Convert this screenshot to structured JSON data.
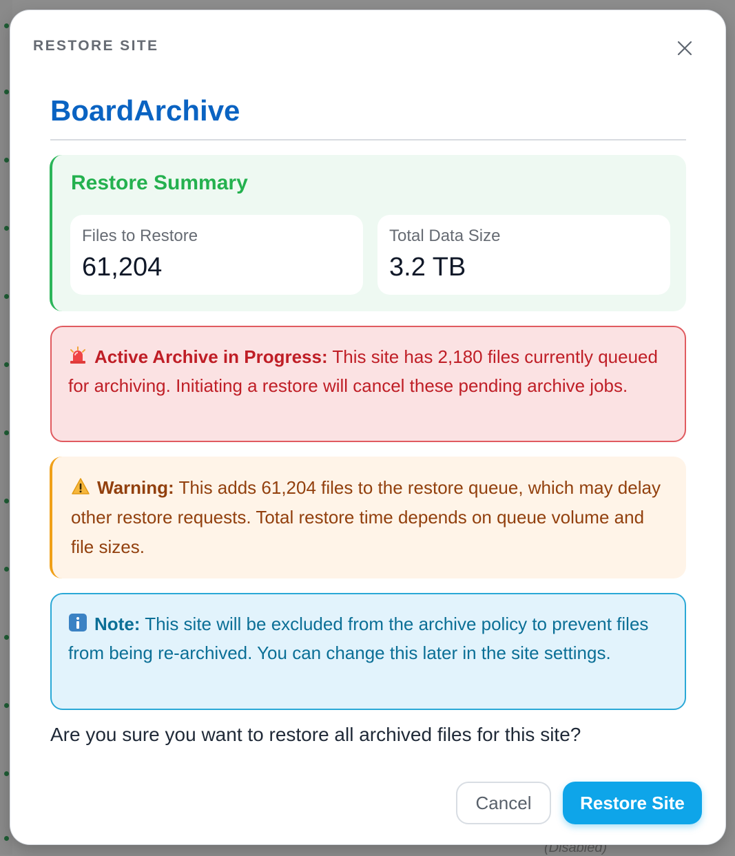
{
  "backdrop": {
    "hint_text": "(Disabled)"
  },
  "modal": {
    "header_label": "RESTORE SITE",
    "site_title": "BoardArchive",
    "summary": {
      "title": "Restore Summary",
      "files_label": "Files to Restore",
      "files_value": "61,204",
      "size_label": "Total Data Size",
      "size_value": "3.2 TB"
    },
    "alert_error": {
      "icon": "siren-icon",
      "title": "Active Archive in Progress:",
      "body": "This site has 2,180 files currently queued for archiving. Initiating a restore will cancel these pending archive jobs."
    },
    "alert_warning": {
      "icon": "warning-triangle-icon",
      "title": "Warning:",
      "body": "This adds 61,204 files to the restore queue, which may delay other restore requests. Total restore time depends on queue volume and file sizes."
    },
    "alert_info": {
      "icon": "info-icon",
      "title": "Note:",
      "body": "This site will be excluded from the archive policy to prevent files from being re-archived. You can change this later in the site settings."
    },
    "confirm_text": "Are you sure you want to restore all archived files for this site?",
    "buttons": {
      "cancel": "Cancel",
      "restore": "Restore Site"
    }
  },
  "colors": {
    "accent": "#0ea5e9",
    "title_blue": "#0a63c2",
    "success": "#24b14f",
    "error": "#bf1e26",
    "warning": "#92400e",
    "info": "#0b6f96"
  }
}
